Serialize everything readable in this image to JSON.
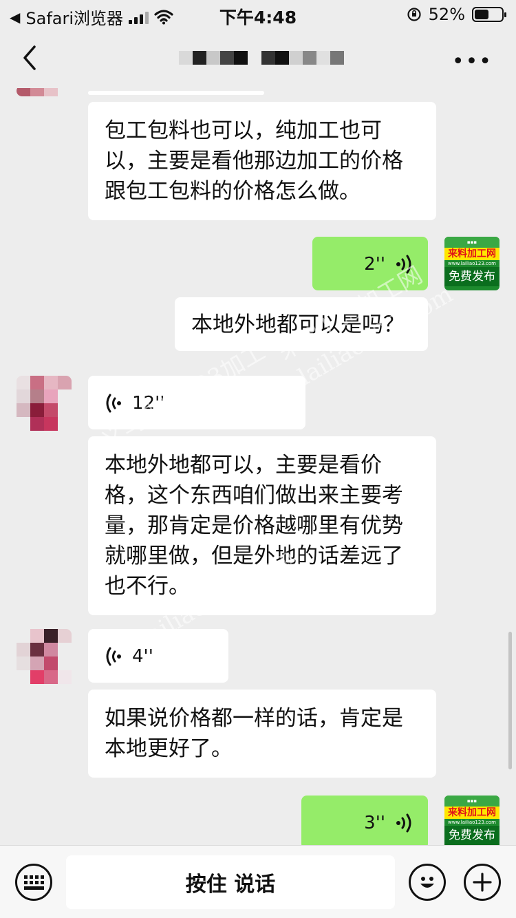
{
  "status_bar": {
    "back_app": "Safari浏览器",
    "time": "下午4:48",
    "battery_percent": "52%",
    "battery_level": 0.52
  },
  "nav": {
    "more_label": "•••"
  },
  "messages": [
    {
      "side": "left",
      "type": "text",
      "text_lines": [
        "包工包料也可以，纯加工也可",
        "以，主要是看他那边加工的价格",
        "跟包工包料的价格怎么做。"
      ]
    },
    {
      "side": "right",
      "type": "voice",
      "duration": "2''"
    },
    {
      "side": "left",
      "type": "text",
      "text": "本地外地都可以是吗？"
    },
    {
      "side": "left",
      "type": "voice",
      "duration": "12''"
    },
    {
      "side": "left",
      "type": "text",
      "text_lines": [
        "本地外地都可以，主要是看价",
        "格，这个东西咱们做出来主要考",
        "量，那肯定是价格越哪里有优势",
        "就哪里做，但是外地的话差远了",
        "也不行。"
      ]
    },
    {
      "side": "left",
      "type": "voice",
      "duration": "4''"
    },
    {
      "side": "left",
      "type": "text",
      "text_lines": [
        "如果说价格都一样的话，肯定是",
        "本地更好了。"
      ]
    },
    {
      "side": "right",
      "type": "voice",
      "duration": "3''"
    }
  ],
  "ad_avatar": {
    "brand": "来料加工网",
    "url": "www.lailiao123.com",
    "free_label": "免费发布"
  },
  "watermarks": [
    "来料123加工网",
    "lailiao123.com",
    "义乌来料123加工",
    "lailiao123.com"
  ],
  "input_bar": {
    "hold_to_talk_label": "按住 说话"
  },
  "icons": {
    "keyboard": "keyboard-icon",
    "emoji": "emoji-icon",
    "add": "plus-icon",
    "voice": "voice-wave-icon"
  },
  "colors": {
    "background": "#ededed",
    "bubble_self": "#95ec69",
    "bubble_other": "#ffffff"
  }
}
